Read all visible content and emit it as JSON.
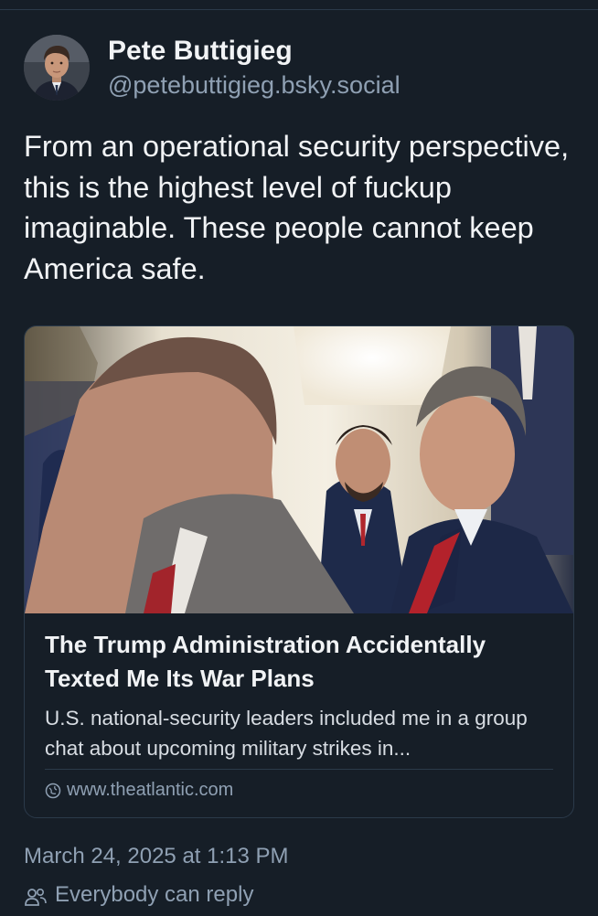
{
  "author": {
    "display_name": "Pete Buttigieg",
    "handle": "@petebuttigieg.bsky.social",
    "avatar_icon": "avatar-photo"
  },
  "post": {
    "text": "From an operational security perspective, this is the highest level of fuckup imaginable. These people cannot keep America safe."
  },
  "link_card": {
    "title": "The Trump Administration Accidentally Texted Me Its War Plans",
    "description": "U.S. national-security leaders included me in a group chat about upcoming military strikes in...",
    "domain": "www.theatlantic.com",
    "domain_icon": "globe-icon"
  },
  "meta": {
    "timestamp": "March 24, 2025 at 1:13 PM",
    "reply_setting": "Everybody can reply",
    "reply_icon": "people-icon"
  },
  "colors": {
    "background": "#161e27",
    "text": "#f1f3f5",
    "muted": "#8fa0b3",
    "border": "#2b3a4a"
  }
}
